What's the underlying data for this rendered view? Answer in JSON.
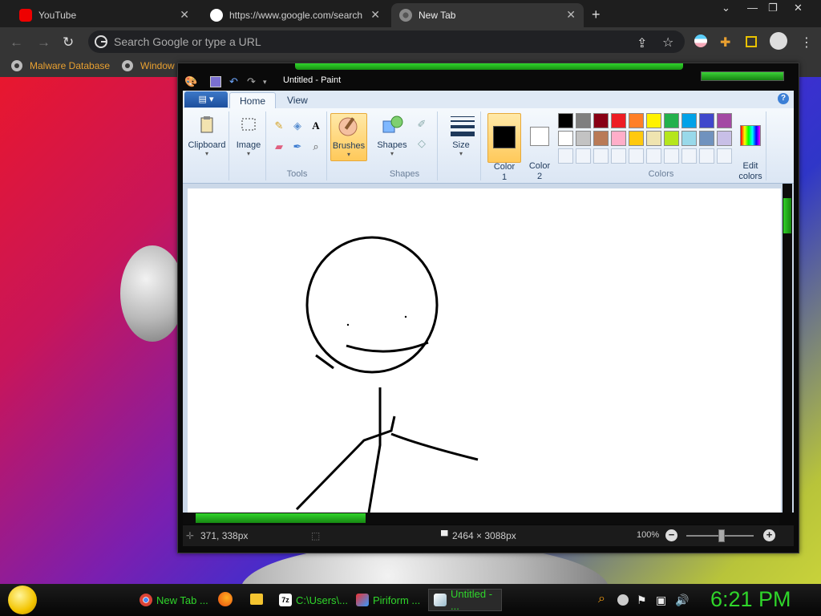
{
  "browser": {
    "tabs": [
      {
        "label": "YouTube",
        "active": false
      },
      {
        "label": "https://www.google.com/search",
        "active": false
      },
      {
        "label": "New Tab",
        "active": true
      }
    ],
    "omnibox_placeholder": "Search Google or type a URL",
    "bookmarks": [
      {
        "label": "Malware Database"
      },
      {
        "label": "Window"
      }
    ]
  },
  "paint": {
    "title": "Untitled - Paint",
    "ribbon_tabs": [
      "Home",
      "View"
    ],
    "help": "?",
    "groups": {
      "clipboard": "Clipboard",
      "image": "Image",
      "tools": "Tools",
      "brushes": "Brushes",
      "shapes_btn": "Shapes",
      "shapes": "Shapes",
      "size": "Size",
      "color1": "Color\n1",
      "color2": "Color\n2",
      "colors": "Colors",
      "edit_colors": "Edit\ncolors"
    },
    "colors": {
      "color1": "#000000",
      "color2": "#ffffff",
      "palette_row1": [
        "#000000",
        "#7f7f7f",
        "#880015",
        "#ed1c24",
        "#ff7f27",
        "#fff200",
        "#22b14c",
        "#00a2e8",
        "#3f48cc",
        "#a349a4"
      ],
      "palette_row2": [
        "#ffffff",
        "#c3c3c3",
        "#b97a57",
        "#ffaec9",
        "#ffc90e",
        "#efe4b0",
        "#b5e61d",
        "#99d9ea",
        "#7092be",
        "#c8bfe7"
      ]
    },
    "status": {
      "cursor_pos": "371, 338px",
      "image_size": "2464 × 3088px",
      "zoom": "100%"
    }
  },
  "taskbar": {
    "items": [
      {
        "label": "New Tab ..."
      },
      {
        "label": "C:\\Users\\..."
      },
      {
        "label": "Piriform ..."
      },
      {
        "label": "Untitled - ..."
      }
    ],
    "clock": "6:21 PM"
  }
}
